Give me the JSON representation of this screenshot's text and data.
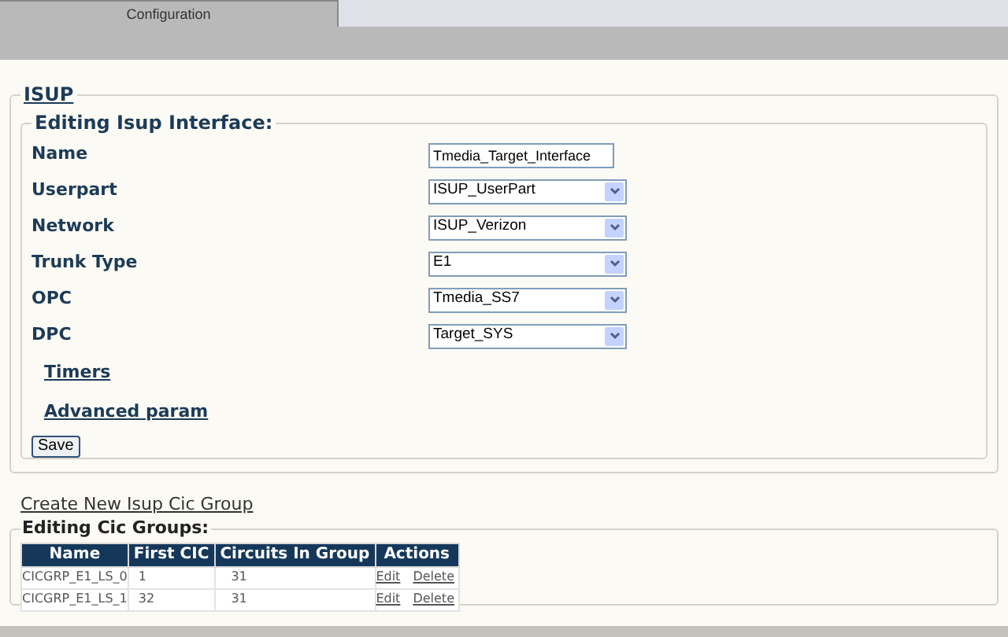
{
  "tabs": [
    {
      "label": "Configuration",
      "selected": true
    }
  ],
  "isup": {
    "legend": "ISUP",
    "interface": {
      "legend": "Editing Isup Interface:",
      "fields": [
        {
          "label": "Name",
          "kind": "text",
          "value": "Tmedia_Target_Interface"
        },
        {
          "label": "Userpart",
          "kind": "select",
          "value": "ISUP_UserPart"
        },
        {
          "label": "Network",
          "kind": "select",
          "value": "ISUP_Verizon"
        },
        {
          "label": "Trunk Type",
          "kind": "select",
          "value": "E1"
        },
        {
          "label": "OPC",
          "kind": "select",
          "value": "Tmedia_SS7"
        },
        {
          "label": "DPC",
          "kind": "select",
          "value": "Target_SYS"
        }
      ],
      "links": [
        "Timers",
        "Advanced param"
      ],
      "save_button": "Save"
    }
  },
  "create_link": "Create New Isup Cic Group",
  "cic_groups": {
    "legend": "Editing Cic Groups:",
    "columns": [
      "Name",
      "First CIC",
      "Circuits In Group",
      "Actions"
    ],
    "rows": [
      {
        "name": "CICGRP_E1_LS_0",
        "first_cic": "1",
        "circuits": "31",
        "actions": [
          "Edit",
          "Delete"
        ]
      },
      {
        "name": "CICGRP_E1_LS_1",
        "first_cic": "32",
        "circuits": "31",
        "actions": [
          "Edit",
          "Delete"
        ]
      }
    ]
  }
}
